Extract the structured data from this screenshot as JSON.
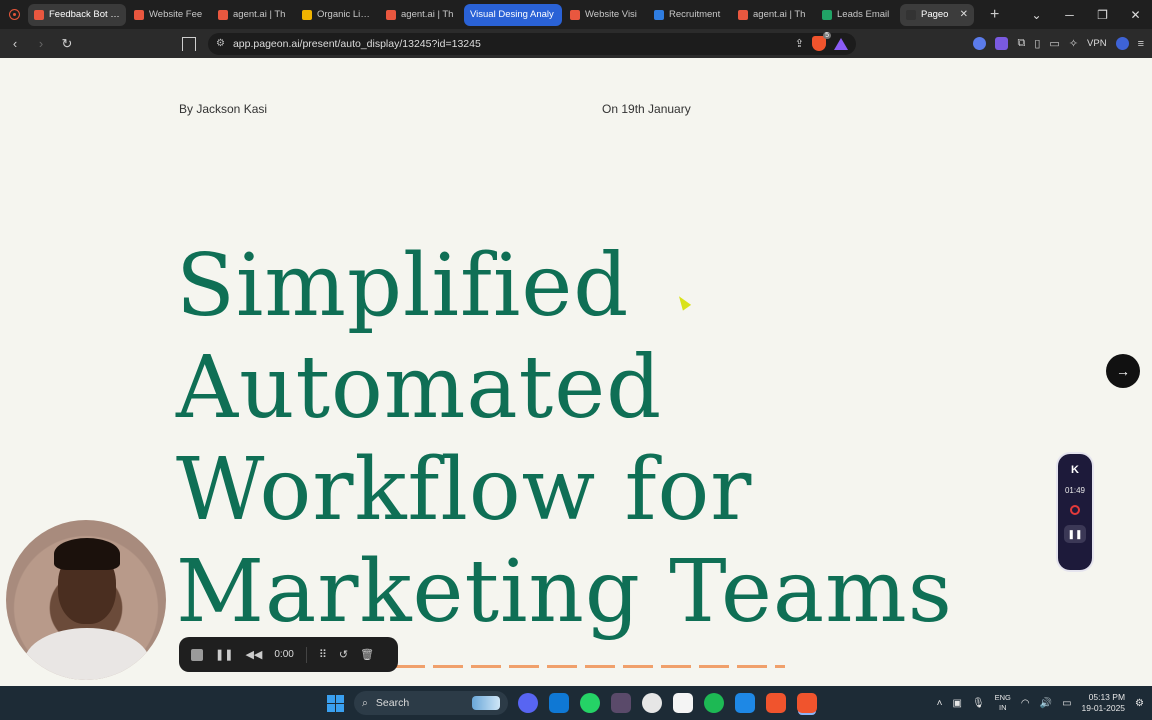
{
  "browser": {
    "tabs": [
      {
        "label": "Feedback Bot (JSON",
        "fav_color": "#e9573f",
        "state": "first"
      },
      {
        "label": "Website Fee",
        "fav_color": "#e9573f",
        "state": ""
      },
      {
        "label": "agent.ai | Th",
        "fav_color": "#e9573f",
        "state": ""
      },
      {
        "label": "Organic Livin",
        "fav_color": "#f1b400",
        "state": ""
      },
      {
        "label": "agent.ai | Th",
        "fav_color": "#e9573f",
        "state": ""
      },
      {
        "label": "Visual Desing Analy",
        "fav_color": "",
        "state": "group"
      },
      {
        "label": "Website Visi",
        "fav_color": "#e9573f",
        "state": ""
      },
      {
        "label": "Recruitment",
        "fav_color": "#2f7de1",
        "state": ""
      },
      {
        "label": "agent.ai | Th",
        "fav_color": "#e9573f",
        "state": ""
      },
      {
        "label": "Leads Email",
        "fav_color": "#21a366",
        "state": ""
      },
      {
        "label": "Pageo",
        "fav_color": "#333333",
        "state": "active"
      }
    ],
    "url": "app.pageon.ai/present/auto_display/13245?id=13245",
    "shield_count": "5",
    "vpn_label": "VPN"
  },
  "slide": {
    "byline": "By Jackson Kasi",
    "date": "On 19th January",
    "title_lines": [
      "Simplified",
      "Automated",
      "Workflow for",
      "Marketing Teams"
    ],
    "accent_color": "#0f6f55"
  },
  "recorder": {
    "logo": "K",
    "time": "01:49"
  },
  "player": {
    "time": "0:00"
  },
  "taskbar": {
    "search_label": "Search",
    "lang_line1": "ENG",
    "lang_line2": "IN",
    "time": "05:13 PM",
    "date": "19-01-2025"
  }
}
